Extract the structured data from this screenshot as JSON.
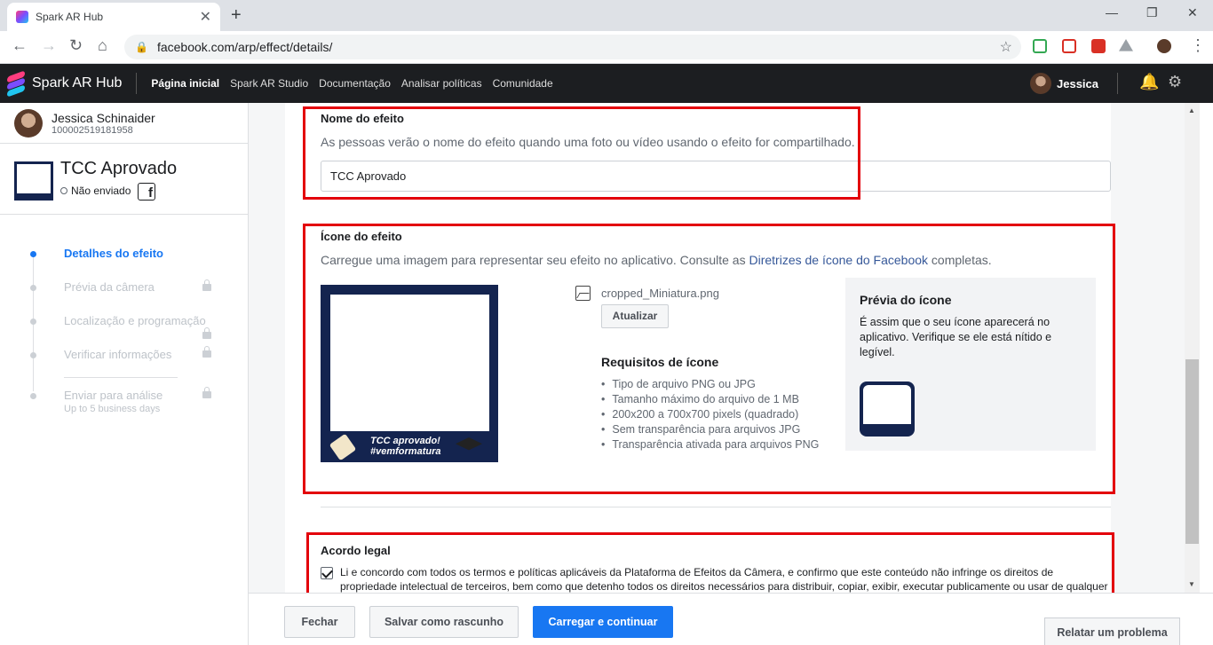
{
  "browser": {
    "tab_title": "Spark AR Hub",
    "tab_close": "✕",
    "new_tab": "+",
    "url": "facebook.com/arp/effect/details/",
    "window_controls": [
      "—",
      "❐",
      "✕"
    ]
  },
  "app_header": {
    "brand": "Spark AR Hub",
    "nav": [
      "Página inicial",
      "Spark AR Studio",
      "Documentação",
      "Analisar políticas",
      "Comunidade"
    ],
    "user_name": "Jessica"
  },
  "sidebar": {
    "user_name": "Jessica Schinaider",
    "user_id": "100002519181958",
    "effect_title": "TCC Aprovado",
    "effect_status": "Não enviado",
    "fb_glyph": "f",
    "steps": [
      {
        "label": "Detalhes do efeito",
        "active": true,
        "locked": false
      },
      {
        "label": "Prévia da câmera",
        "active": false,
        "locked": true
      },
      {
        "label": "Localização e programação",
        "active": false,
        "locked": true
      },
      {
        "label": "Verificar informações",
        "active": false,
        "locked": true
      },
      {
        "label": "Enviar para análise",
        "active": false,
        "locked": true
      }
    ],
    "submit_sublabel": "Up to 5 business days"
  },
  "name_section": {
    "title": "Nome do efeito",
    "description": "As pessoas verão o nome do efeito quando uma foto ou vídeo usando o efeito for compartilhado.",
    "value": "TCC Aprovado"
  },
  "icon_section": {
    "title": "Ícone do efeito",
    "description_before": "Carregue uma imagem para representar seu efeito no aplicativo. Consulte as ",
    "description_link": "Diretrizes de ícone do Facebook",
    "description_after": " completas.",
    "thumb_caption_line1": "TCC aprovado!",
    "thumb_caption_line2": "#vemformatura",
    "file_name": "cropped_Miniatura.png",
    "update_button": "Atualizar",
    "requirements_title": "Requisitos de ícone",
    "requirements": [
      "Tipo de arquivo PNG ou JPG",
      "Tamanho máximo do arquivo de 1 MB",
      "200x200 a 700x700 pixels (quadrado)",
      "Sem transparência para arquivos JPG",
      "Transparência ativada para arquivos PNG"
    ],
    "preview_title": "Prévia do ícone",
    "preview_description": "É assim que o seu ícone aparecerá no aplicativo. Verifique se ele está nítido e legível."
  },
  "legal_section": {
    "title": "Acordo legal",
    "checked": true,
    "text": "Li e concordo com todos os termos e políticas aplicáveis da Plataforma de Efeitos da Câmera, e confirmo que este conteúdo não infringe os direitos de propriedade intelectual de terceiros, bem como que detenho todos os direitos necessários para distribuir, copiar, exibir, executar publicamente ou usar de qualquer"
  },
  "footer": {
    "close": "Fechar",
    "save_draft": "Salvar como rascunho",
    "upload": "Carregar e continuar",
    "report": "Relatar um problema"
  },
  "colors": {
    "accent": "#1877f2",
    "highlight": "#e3000b",
    "header_bg": "#1c1e21",
    "thumb_navy": "#14244f"
  },
  "icons": [
    "spark-ar-logo-icon",
    "lock-icon",
    "star-icon",
    "bell-icon",
    "gear-icon",
    "image-file-icon",
    "facebook-icon",
    "checkbox-icon"
  ]
}
